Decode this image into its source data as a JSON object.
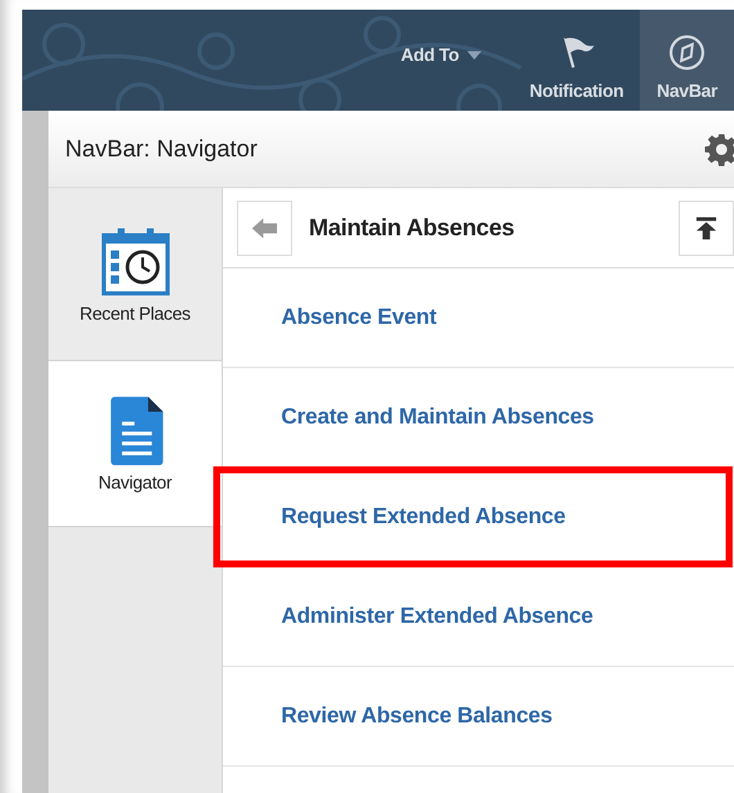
{
  "header": {
    "actions": [
      {
        "kind": "menu",
        "label": "Add To",
        "selected": false
      },
      {
        "kind": "flag",
        "label": "Notification",
        "selected": false
      },
      {
        "kind": "compass",
        "label": "NavBar",
        "selected": true
      }
    ]
  },
  "panel": {
    "title": "NavBar: Navigator"
  },
  "sidebar": {
    "items": [
      {
        "kind": "calendar",
        "label": "Recent Places",
        "selected": false
      },
      {
        "kind": "document",
        "label": "Navigator",
        "selected": true
      }
    ]
  },
  "content": {
    "title": "Maintain Absences",
    "items": [
      {
        "label": "Absence Event",
        "highlighted": false
      },
      {
        "label": "Create and Maintain Absences",
        "highlighted": false
      },
      {
        "label": "Request Extended Absence",
        "highlighted": true
      },
      {
        "label": "Administer Extended Absence",
        "highlighted": false
      },
      {
        "label": "Review Absence Balances",
        "highlighted": false
      }
    ]
  }
}
